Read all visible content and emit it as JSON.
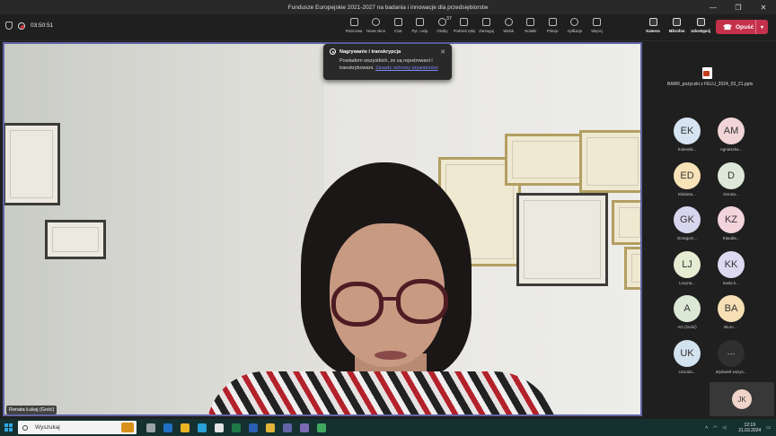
{
  "window": {
    "title": "Fundusze Europejskie 2021-2027 na badania i innowacje dla przedsiębiorstw",
    "controls": [
      "—",
      "❐",
      "✕"
    ]
  },
  "meeting": {
    "timer": "03:50:51",
    "tools": [
      {
        "label": "Rozmowa",
        "icon": "chat-icon"
      },
      {
        "label": "Nowe okno",
        "icon": "new-window-icon"
      },
      {
        "label": "Czat",
        "icon": "chat-bubble-icon"
      },
      {
        "label": "Pyt. i odp.",
        "icon": "qa-icon"
      },
      {
        "label": "Osoby",
        "icon": "people-icon",
        "badge": "37"
      },
      {
        "label": "Podnieś rękę",
        "icon": "raise-hand-icon"
      },
      {
        "label": "Zareaguj",
        "icon": "react-icon"
      },
      {
        "label": "Widok",
        "icon": "view-icon"
      },
      {
        "label": "Notatki",
        "icon": "notes-icon"
      },
      {
        "label": "Pokoje",
        "icon": "rooms-icon"
      },
      {
        "label": "Aplikacje",
        "icon": "apps-icon"
      },
      {
        "label": "Więcej",
        "icon": "more-icon"
      }
    ],
    "devices": [
      {
        "label": "Kamera",
        "icon": "camera-icon"
      },
      {
        "label": "Mikrofon",
        "icon": "microphone-icon"
      },
      {
        "label": "Udostępnij",
        "icon": "share-icon"
      }
    ],
    "leave_label": "Opuść",
    "speaker_name": "Renata Łukaj (Gość)"
  },
  "notification": {
    "title": "Nagrywanie i transkrypcja",
    "text": "Powiadom wszystkich, że są rejestrowani i transkrybowani.",
    "link": "Zasady ochrony prywatności",
    "close": "✕"
  },
  "shared_file": {
    "name": "BARR_pożyczki z FELU_2024_03_21.pptx"
  },
  "participants": [
    {
      "initials": "EK",
      "name": "Kolesnik...",
      "color": "#d6e4f2"
    },
    {
      "initials": "AM",
      "name": "Agnieszka...",
      "color": "#f0d4d6"
    },
    {
      "initials": "ED",
      "name": "Elsbieta...",
      "color": "#f8e2b8"
    },
    {
      "initials": "D",
      "name": "Dorota...",
      "color": "#dde8d8"
    },
    {
      "initials": "GK",
      "name": "Grzegorz...",
      "color": "#d8d6ee"
    },
    {
      "initials": "KZ",
      "name": "Klaudia...",
      "color": "#f3d3dc"
    },
    {
      "initials": "LJ",
      "name": "Lucyna...",
      "color": "#e6ecd2"
    },
    {
      "initials": "KK",
      "name": "kasia k...",
      "color": "#dcd9f1"
    },
    {
      "initials": "A",
      "name": "AG (Gość)",
      "color": "#dce8d6"
    },
    {
      "initials": "BA",
      "name": "Biuro ...",
      "color": "#f6dfb5"
    },
    {
      "initials": "UK",
      "name": "Urszula...",
      "color": "#d3e2ef"
    },
    {
      "initials": "···",
      "name": "Wyświetl wszys...",
      "color": "#2f2f2f"
    }
  ],
  "self_view": {
    "initials": "JK"
  },
  "taskbar": {
    "search_placeholder": "Wyszukaj",
    "time": "12:19",
    "date": "21.03.2024",
    "tray_icons": [
      "chevron-up-icon",
      "wifi-icon",
      "volume-icon",
      "notifications-icon"
    ],
    "apps": [
      {
        "icon": "task-view-icon",
        "color": "#9aa3a8"
      },
      {
        "icon": "outlook-icon",
        "color": "#1f6fc4"
      },
      {
        "icon": "explorer-icon",
        "color": "#e8b424"
      },
      {
        "icon": "edge-icon",
        "color": "#2aa0d8"
      },
      {
        "icon": "calendar-icon",
        "color": "#e4e4e4"
      },
      {
        "icon": "excel-icon",
        "color": "#1d7a45"
      },
      {
        "icon": "word-icon",
        "color": "#2b5fb5"
      },
      {
        "icon": "chrome-icon",
        "color": "#e2b53a"
      },
      {
        "icon": "teams-icon",
        "color": "#6264a7"
      },
      {
        "icon": "teams-active-icon",
        "color": "#7b6bb3"
      },
      {
        "icon": "photos-icon",
        "color": "#41a85f"
      }
    ]
  }
}
